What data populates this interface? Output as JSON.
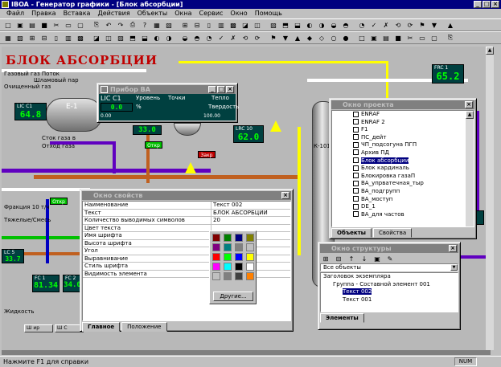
{
  "app": {
    "title": "IBOA - Генератор графики - [Блок абсорбции]",
    "menu": [
      "Файл",
      "Правка",
      "Вставка",
      "Действия",
      "Объекты",
      "Окна",
      "Сервис",
      "Окно",
      "Помощь"
    ],
    "status_left": "Нажмите F1 для справки",
    "status_num": "NUM"
  },
  "scada": {
    "title": "БЛОК АБСОРБЦИИ",
    "labels": {
      "top_left1": "Газовый газ Поток",
      "top_left2": "Шламовый пар",
      "top_left3": "Очищенный газ",
      "left_mid": "Сток газа в",
      "left_mid2": "Отход газа",
      "left_low": "Фракция 10 т/ч",
      "left_low2": "Тяжелые/Смесь",
      "vessel": "Е-1",
      "column": "К-101",
      "bottom_left": "Жидкость",
      "sh1": "Ш ир",
      "sh2": "Ш С"
    },
    "tags": [
      {
        "name": "LIC C1",
        "value": "64.8"
      },
      {
        "name": "FRC 1",
        "value": "65.2"
      },
      {
        "name": "LRC 10",
        "value": "62.0"
      },
      {
        "name": "LIC C1",
        "value": "33.0"
      },
      {
        "name": "FC 1",
        "value": "81.34"
      },
      {
        "name": "FC 2",
        "value": "34.0"
      },
      {
        "name": "LC 5",
        "value": "33.7"
      }
    ],
    "buttons": {
      "open1": "Откр",
      "open2": "Откр",
      "close1": "Закр"
    }
  },
  "pribor": {
    "title": "Прибор ВА",
    "tag": "LIC C1",
    "col1": "Уровень",
    "col2": "Точки",
    "col3": "Тепло",
    "value": "0.0",
    "unit": "%",
    "temp_label": "Твердость",
    "scale_min": "0.00",
    "scale_max": "100.00"
  },
  "objects_window": {
    "title": "Окно проекта",
    "items": [
      "ENRAF",
      "ENRAF 2",
      "F1",
      "ПС_дейт",
      "ЧП_подсогуна ПГП",
      "Архив ПД",
      "Блок абсорбции",
      "Блок кардиналь",
      "Блокировка газаП",
      "ВА_упрватечная_тыр",
      "ВА_подгрупп",
      "ВА_моступ",
      "DE_1",
      "ВА_для частов"
    ],
    "selected_index": 6,
    "tabs": [
      "Объекты",
      "Свойства"
    ]
  },
  "props_window": {
    "title": "Окно свойств",
    "rows": [
      {
        "k": "Наименование",
        "v": "Текст 002"
      },
      {
        "k": "Текст",
        "v": "БЛОК АБСОРБЦИИ"
      },
      {
        "k": "Количество выводимых символов",
        "v": "20"
      },
      {
        "k": "Цвет текста",
        "v": ""
      },
      {
        "k": "Имя шрифта",
        "v": ""
      },
      {
        "k": "Высота шрифта",
        "v": ""
      },
      {
        "k": "Угол",
        "v": ""
      },
      {
        "k": "Выравнивание",
        "v": ""
      },
      {
        "k": "Стиль шрифта",
        "v": ""
      },
      {
        "k": "Видимость элемента",
        "v": ""
      }
    ],
    "other_btn": "Другие...",
    "tabs": [
      "Главное",
      "Положение"
    ],
    "palette": [
      "#800000",
      "#008000",
      "#000080",
      "#808000",
      "#800080",
      "#008080",
      "#808080",
      "#c0c0c0",
      "#ff0000",
      "#00ff00",
      "#0000ff",
      "#ffff00",
      "#ff00ff",
      "#00ffff",
      "#000000",
      "#ffffff",
      "#c0c0c0",
      "#808080",
      "#404040",
      "#ff8000",
      "#0080ff",
      "#ffffff"
    ]
  },
  "struct_window": {
    "title": "Окно структуры",
    "combo_value": "Все объекты",
    "items": [
      {
        "text": "Заголовок экземпляра",
        "level": 0
      },
      {
        "text": "Группа - Составной элемент 001",
        "level": 1
      },
      {
        "text": "Текст 002",
        "level": 2,
        "selected": true
      },
      {
        "text": "Текст 001",
        "level": 2
      }
    ],
    "tab": "Элементы"
  }
}
